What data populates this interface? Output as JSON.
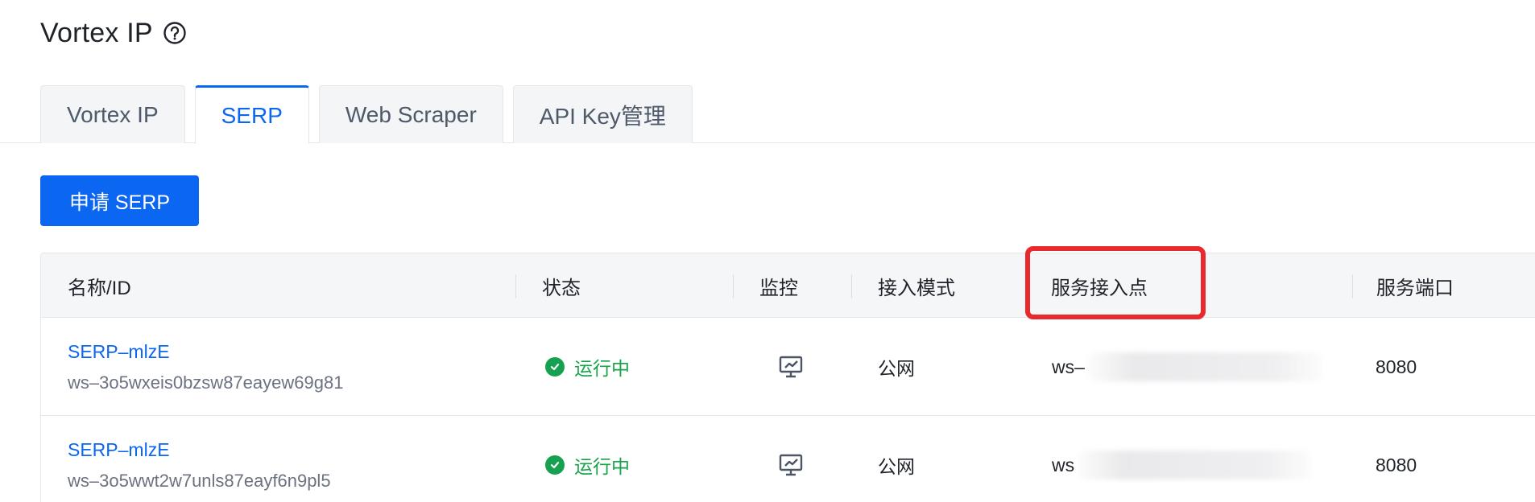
{
  "header": {
    "title": "Vortex IP",
    "help_icon": "question-circle-icon"
  },
  "tabs": [
    {
      "label": "Vortex IP",
      "active": false
    },
    {
      "label": "SERP",
      "active": true
    },
    {
      "label": "Web Scraper",
      "active": false
    },
    {
      "label": "API Key管理",
      "active": false
    }
  ],
  "actions": {
    "apply_label": "申请 SERP"
  },
  "table": {
    "columns": [
      "名称/ID",
      "状态",
      "监控",
      "接入模式",
      "服务接入点",
      "服务端口"
    ],
    "rows": [
      {
        "name": "SERP–mlzE",
        "id": "ws–3o5wxeis0bzsw87eayew69g81",
        "status": "运行中",
        "mode": "公网",
        "endpoint": "ws–",
        "port": "8080"
      },
      {
        "name": "SERP–mlzE",
        "id": "ws–3o5wwt2w7unls87eayf6n9pl5",
        "status": "运行中",
        "mode": "公网",
        "endpoint": "ws",
        "port": "8080"
      }
    ]
  },
  "colors": {
    "accent": "#0b66f2",
    "status_green": "#15a150",
    "highlight_red": "#e8292e"
  }
}
